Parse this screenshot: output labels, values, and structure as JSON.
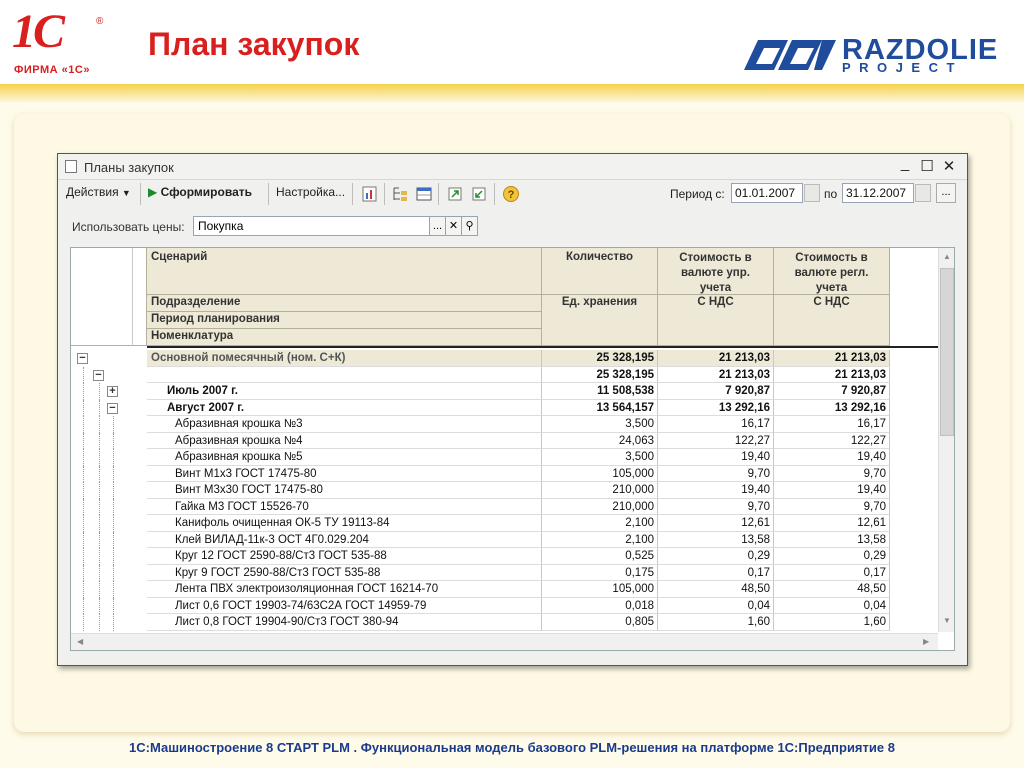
{
  "header": {
    "logo_1c": "1С",
    "logo_firm": "ФИРМА «1С»",
    "title": "План закупок",
    "partner_name": "RAZDOLIE",
    "partner_sub": "PROJECT"
  },
  "footer": "1С:Машиностроение 8 СТАРТ PLM . Функциональная модель базового PLM-решения на платформе 1С:Предприятие 8",
  "window": {
    "title": "Планы закупок",
    "toolbar": {
      "actions": "Действия",
      "generate": "Сформировать",
      "settings": "Настройка...",
      "period_from_label": "Период с:",
      "period_from": "01.01.2007",
      "period_to_label": "по",
      "period_to": "31.12.2007",
      "more": "..."
    },
    "prices": {
      "label": "Использовать цены:",
      "value": "Покупка"
    },
    "grid": {
      "headers": {
        "scenario": "Сценарий",
        "division": "Подразделение",
        "period": "Период планирования",
        "nomenclature": "Номенклатура",
        "qty": "Количество",
        "unit": "Ед. хранения",
        "cost_mgmt": "Стоимость в валюте упр. учета",
        "cost_reg": "Стоимость в валюте регл. учета",
        "vat1": "С НДС",
        "vat2": "С НДС"
      },
      "rows": [
        {
          "name": "Основной помесячный (ном. С+К)",
          "qty": "25 328,195",
          "c1": "21 213,03",
          "c2": "21 213,03"
        },
        {
          "name": "",
          "qty": "25 328,195",
          "c1": "21 213,03",
          "c2": "21 213,03"
        },
        {
          "name": "Июль 2007 г.",
          "qty": "11 508,538",
          "c1": "7 920,87",
          "c2": "7 920,87"
        },
        {
          "name": "Август 2007 г.",
          "qty": "13 564,157",
          "c1": "13 292,16",
          "c2": "13 292,16"
        },
        {
          "name": "Абразивная крошка №3",
          "qty": "3,500",
          "c1": "16,17",
          "c2": "16,17"
        },
        {
          "name": "Абразивная крошка №4",
          "qty": "24,063",
          "c1": "122,27",
          "c2": "122,27"
        },
        {
          "name": "Абразивная крошка №5",
          "qty": "3,500",
          "c1": "19,40",
          "c2": "19,40"
        },
        {
          "name": "Винт М1х3 ГОСТ 17475-80",
          "qty": "105,000",
          "c1": "9,70",
          "c2": "9,70"
        },
        {
          "name": "Винт М3х30 ГОСТ 17475-80",
          "qty": "210,000",
          "c1": "19,40",
          "c2": "19,40"
        },
        {
          "name": "Гайка М3 ГОСТ 15526-70",
          "qty": "210,000",
          "c1": "9,70",
          "c2": "9,70"
        },
        {
          "name": "Канифоль очищенная ОК-5 ТУ 19113-84",
          "qty": "2,100",
          "c1": "12,61",
          "c2": "12,61"
        },
        {
          "name": "Клей ВИЛАД-11к-3 ОСТ 4Г0.029.204",
          "qty": "2,100",
          "c1": "13,58",
          "c2": "13,58"
        },
        {
          "name": "Круг 12 ГОСТ 2590-88/Ст3 ГОСТ 535-88",
          "qty": "0,525",
          "c1": "0,29",
          "c2": "0,29"
        },
        {
          "name": "Круг 9 ГОСТ 2590-88/Ст3 ГОСТ 535-88",
          "qty": "0,175",
          "c1": "0,17",
          "c2": "0,17"
        },
        {
          "name": "Лента ПВХ электроизоляционная ГОСТ 16214-70",
          "qty": "105,000",
          "c1": "48,50",
          "c2": "48,50"
        },
        {
          "name": "Лист 0,6 ГОСТ 19903-74/63С2А ГОСТ 14959-79",
          "qty": "0,018",
          "c1": "0,04",
          "c2": "0,04"
        },
        {
          "name": "Лист 0,8 ГОСТ 19904-90/Ст3 ГОСТ 380-94",
          "qty": "0,805",
          "c1": "1,60",
          "c2": "1,60"
        }
      ]
    }
  }
}
